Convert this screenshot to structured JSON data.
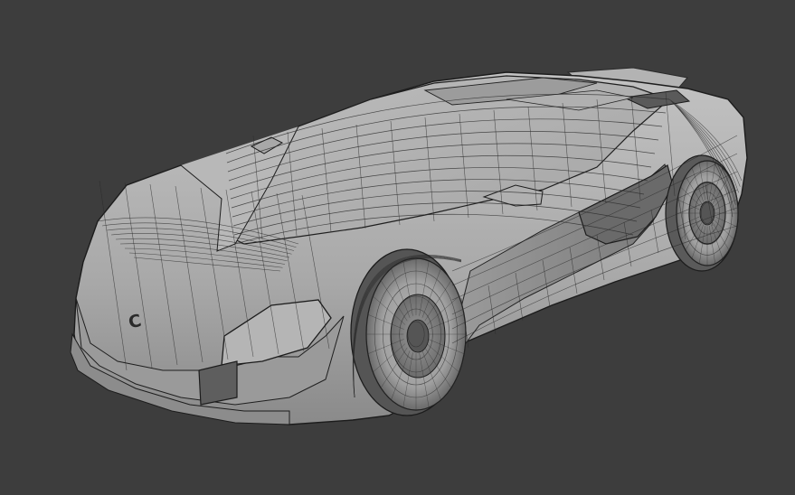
{
  "scene": {
    "background_color": "#3d3d3d",
    "body_color": "#a9a9a9",
    "body_shadow_color": "#7e7e7e",
    "body_highlight_color": "#c4c4c4",
    "wire_color": "#2a2a2a",
    "dark_color": "#4a4a4a"
  },
  "model": {
    "badge_glyph": "C"
  }
}
